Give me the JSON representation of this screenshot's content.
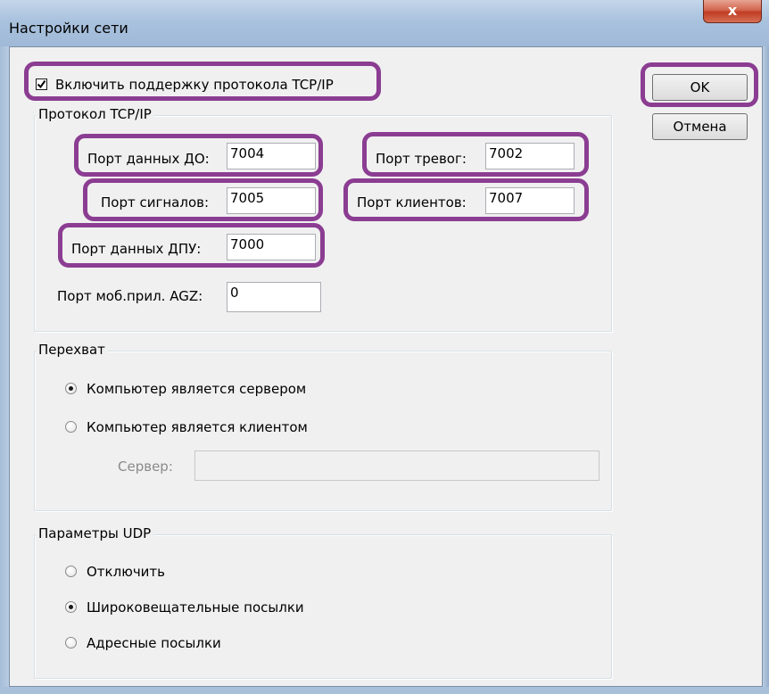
{
  "window": {
    "title": "Настройки сети",
    "close_glyph": "x"
  },
  "tcp": {
    "enable_label": "Включить поддержку протокола TCP/IP",
    "enable_checked": true,
    "group_title": "Протокол TCP/IP",
    "data_do_port": {
      "label": "Порт данных ДО:",
      "value": "7004"
    },
    "alarm_port": {
      "label": "Порт тревог:",
      "value": "7002"
    },
    "signal_port": {
      "label": "Порт сигналов:",
      "value": "7005"
    },
    "client_port": {
      "label": "Порт клиентов:",
      "value": "7007"
    },
    "data_dpu_port": {
      "label": "Порт данных ДПУ:",
      "value": "7000"
    },
    "mobile_port": {
      "label": "Порт моб.прил. AGZ:",
      "value": "0"
    }
  },
  "intercept": {
    "group_title": "Перехват",
    "option_server": "Компьютер является сервером",
    "option_client": "Компьютер является клиентом",
    "selected": "server",
    "server_label": "Сервер:",
    "server_value": ""
  },
  "udp": {
    "group_title": "Параметры UDP",
    "option_off": "Отключить",
    "option_broadcast": "Широковещательные посылки",
    "option_address": "Адресные посылки",
    "selected": "broadcast"
  },
  "buttons": {
    "ok": "OK",
    "cancel": "Отмена"
  },
  "colors": {
    "highlight": "#8b3d92",
    "title_bar": "#a9c2de",
    "close_button": "#c03c22"
  }
}
